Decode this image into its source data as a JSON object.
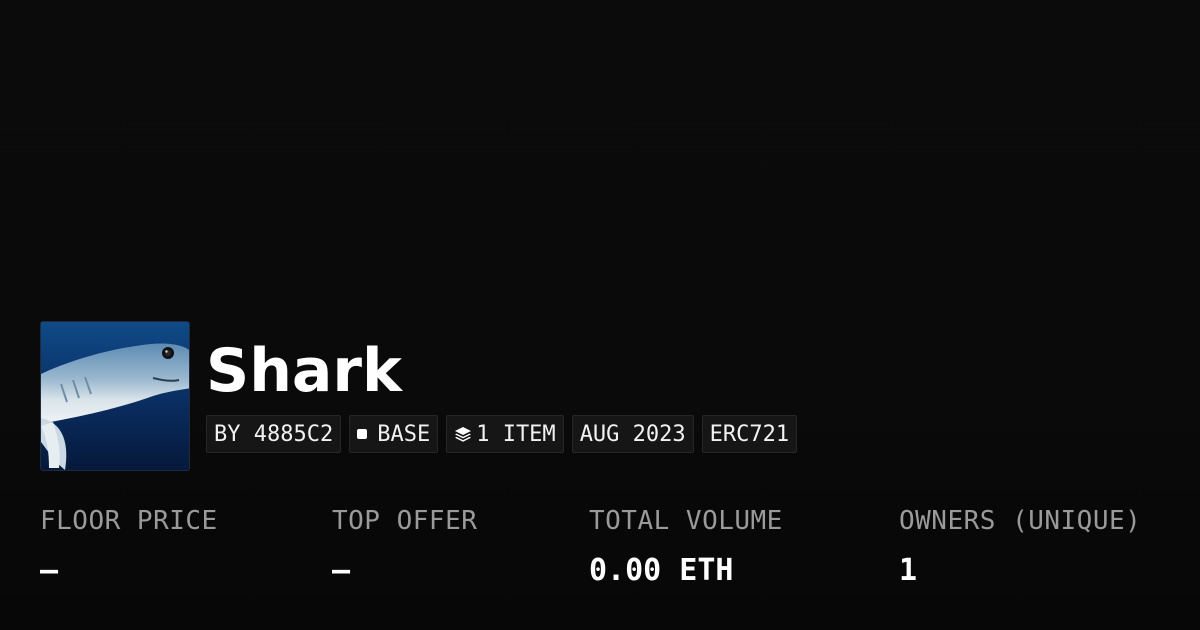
{
  "collection": {
    "name": "Shark",
    "avatar_icon": "shark-image"
  },
  "badges": {
    "creator": "BY 4885C2",
    "chain": "BASE",
    "items": "1 ITEM",
    "date": "AUG 2023",
    "standard": "ERC721"
  },
  "stats": [
    {
      "label": "FLOOR PRICE",
      "value": "—"
    },
    {
      "label": "TOP OFFER",
      "value": "—"
    },
    {
      "label": "TOTAL VOLUME",
      "value": "0.00 ETH"
    },
    {
      "label": "OWNERS (UNIQUE)",
      "value": "1"
    }
  ],
  "colors": {
    "background": "#0b0b0b",
    "badge_bg": "#161616",
    "label": "#9a9a9a",
    "text": "#ffffff"
  }
}
